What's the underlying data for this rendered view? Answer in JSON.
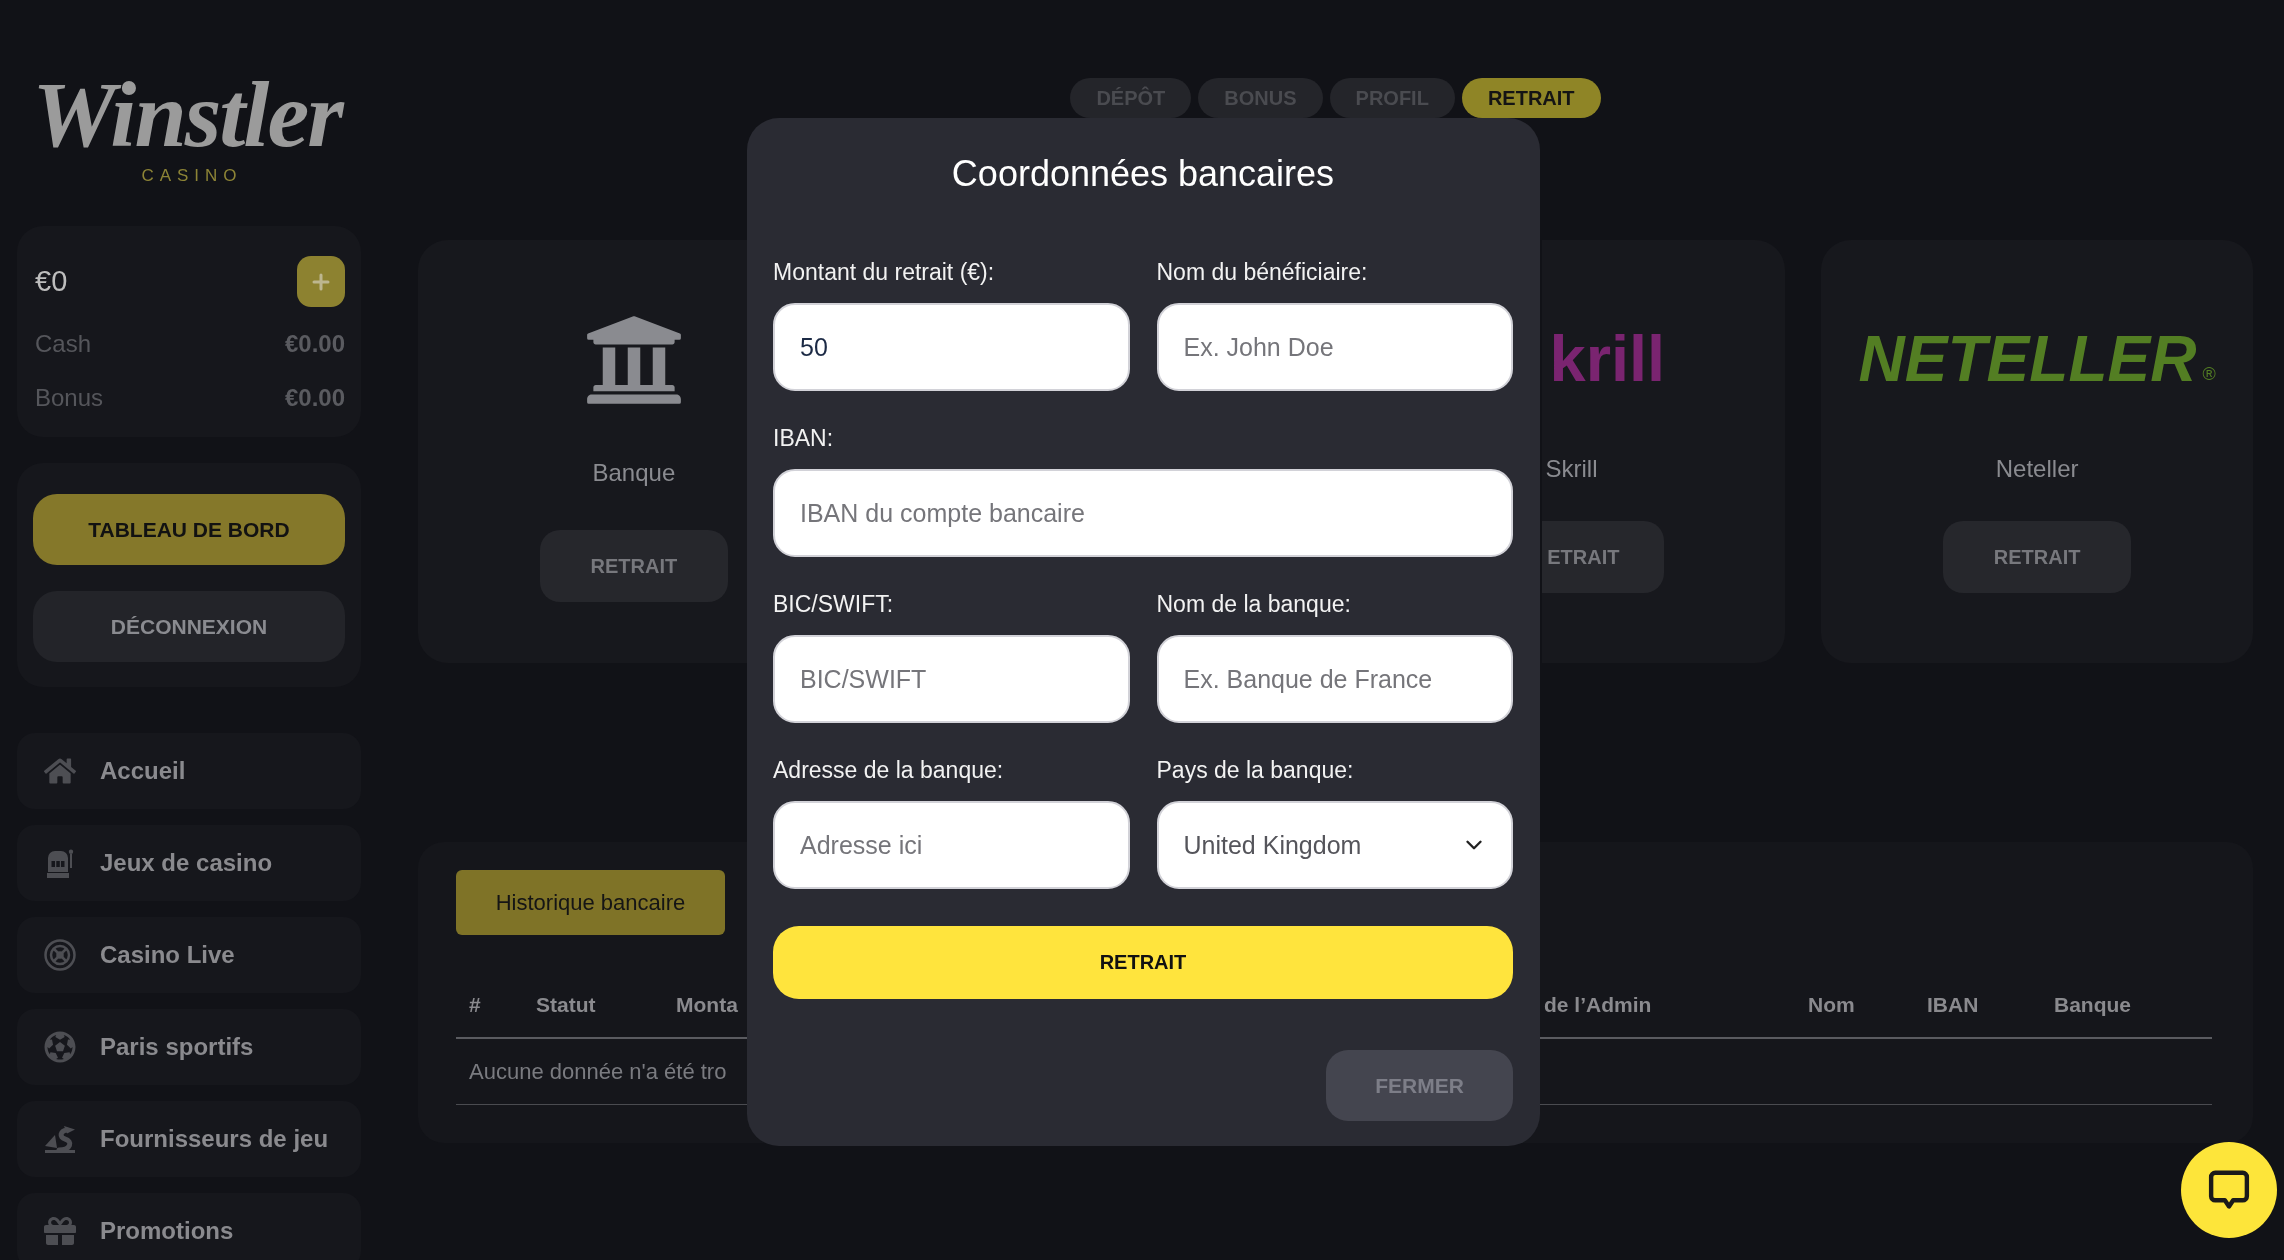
{
  "sidebar": {
    "logo": "Winstler",
    "logo_tagline": "CASINO",
    "balance": {
      "total": "€0",
      "rows": [
        {
          "label": "Cash",
          "value": "€0.00"
        },
        {
          "label": "Bonus",
          "value": "€0.00"
        }
      ]
    },
    "actions": [
      {
        "label": "TABLEAU DE BORD",
        "kind": "primary"
      },
      {
        "label": "DÉCONNEXION",
        "kind": "secondary"
      }
    ],
    "nav": [
      {
        "label": "Accueil"
      },
      {
        "label": "Jeux de casino"
      },
      {
        "label": "Casino Live"
      },
      {
        "label": "Paris sportifs"
      },
      {
        "label": "Fournisseurs de jeu"
      },
      {
        "label": "Promotions"
      }
    ]
  },
  "tabs": [
    {
      "label": "DÉPÔT",
      "selected": false
    },
    {
      "label": "BONUS",
      "selected": false
    },
    {
      "label": "PROFIL",
      "selected": false
    },
    {
      "label": "RETRAIT",
      "selected": true
    }
  ],
  "methods": [
    {
      "kind": "bank",
      "label": "Banque",
      "button": "RETRAIT"
    },
    {
      "kind": "skrill",
      "logo": "krill",
      "label": "Skrill",
      "button": "ETRAIT"
    },
    {
      "kind": "neteller",
      "logo": "NETELLER",
      "logo_mark": "®",
      "label": "Neteller",
      "button": "RETRAIT"
    }
  ],
  "history": {
    "tab": "Historique bancaire",
    "columns": [
      "#",
      "Statut",
      "Monta",
      "de l’Admin",
      "Nom",
      "IBAN",
      "Banque"
    ],
    "empty_message": "Aucune donnée n'a été tro"
  },
  "modal": {
    "title": "Coordonnées bancaires",
    "rows": [
      [
        {
          "kind": "input",
          "label": "Montant du retrait (€):",
          "value": "50"
        },
        {
          "kind": "input",
          "label": "Nom du bénéficiaire:",
          "placeholder": "Ex. John Doe"
        }
      ],
      [
        {
          "kind": "input",
          "label": "IBAN:",
          "placeholder": "IBAN du compte bancaire"
        }
      ],
      [
        {
          "kind": "input",
          "label": "BIC/SWIFT:",
          "placeholder": "BIC/SWIFT"
        },
        {
          "kind": "input",
          "label": "Nom de la banque:",
          "placeholder": "Ex. Banque de France"
        }
      ],
      [
        {
          "kind": "input",
          "label": "Adresse de la banque:",
          "placeholder": "Adresse ici"
        },
        {
          "kind": "select",
          "label": "Pays de la banque:",
          "value": "United Kingdom"
        }
      ]
    ],
    "submit": "RETRAIT",
    "close": "FERMER"
  }
}
